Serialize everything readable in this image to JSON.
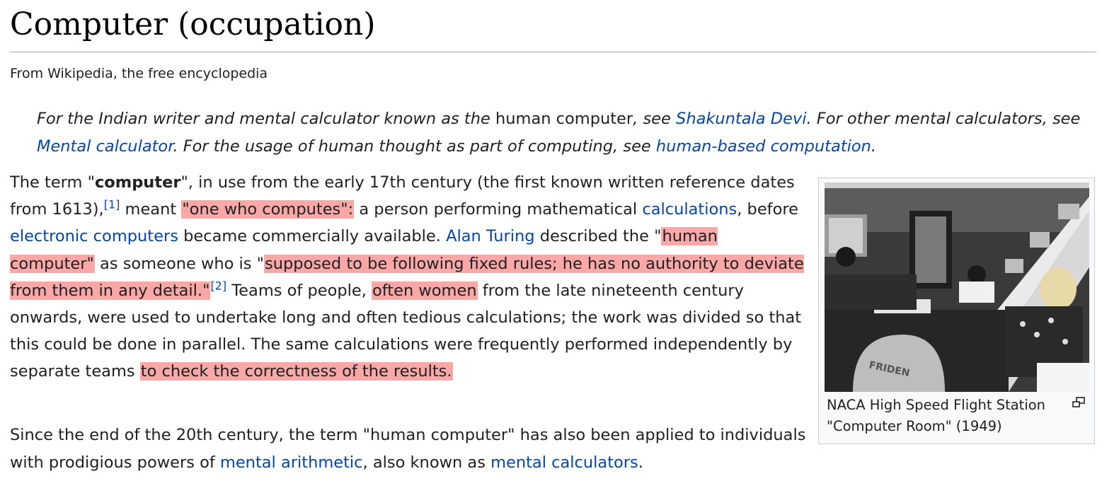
{
  "page": {
    "title": "Computer (occupation)",
    "tagline": "From Wikipedia, the free encyclopedia"
  },
  "hatnote": {
    "part1": "For the Indian writer and mental calculator known as the ",
    "term": "human computer",
    "part2": ", see ",
    "link1": "Shakuntala Devi",
    "part3": ". For other mental calculators, see ",
    "link2": "Mental calculator",
    "part4": ". For the usage of human thought as part of computing, see ",
    "link3": "human-based computation",
    "part5": "."
  },
  "paragraph1": {
    "t1": "The term \"",
    "bold": "computer",
    "t2": "\", in use from the early 17th century (the first known written reference dates from 1613),",
    "ref1": "[1]",
    "t3": " meant ",
    "hl1": "\"one who computes\":",
    "t4": " a person performing mathematical ",
    "link_calculations": "calculations",
    "t5": ", before ",
    "link_electronic": "electronic computers",
    "t6": " became commercially available. ",
    "link_turing": "Alan Turing",
    "t7": " described the \"",
    "hl2": "human computer\"",
    "t8": " as someone who is \"",
    "hl3": "supposed to be following fixed rules; he has no authority to deviate from them in any detail.\"",
    "ref2": "[2]",
    "t9": " Teams of people, ",
    "hl4": "often women",
    "t10": " from the late nineteenth century onwards, were used to undertake long and often tedious calculations; the work was divided so that this could be done in parallel. The same calculations were frequently performed independently by separate teams ",
    "hl5": "to check the correctness of the results."
  },
  "paragraph2": {
    "t1": "Since the end of the 20th century, the term \"human computer\" has also been applied to individuals with prodigious powers of ",
    "link1": "mental arithmetic",
    "t2": ", also known as ",
    "link2": "mental calculators",
    "t3": "."
  },
  "figure": {
    "image_text": "FRIDEN",
    "caption": "NACA High Speed Flight Station \"Computer Room\" (1949)",
    "icon": "enlarge-icon"
  },
  "colors": {
    "link": "#0645ad",
    "highlight": "#f9a7a7",
    "text": "#202122",
    "rule": "#a2a9b1"
  }
}
